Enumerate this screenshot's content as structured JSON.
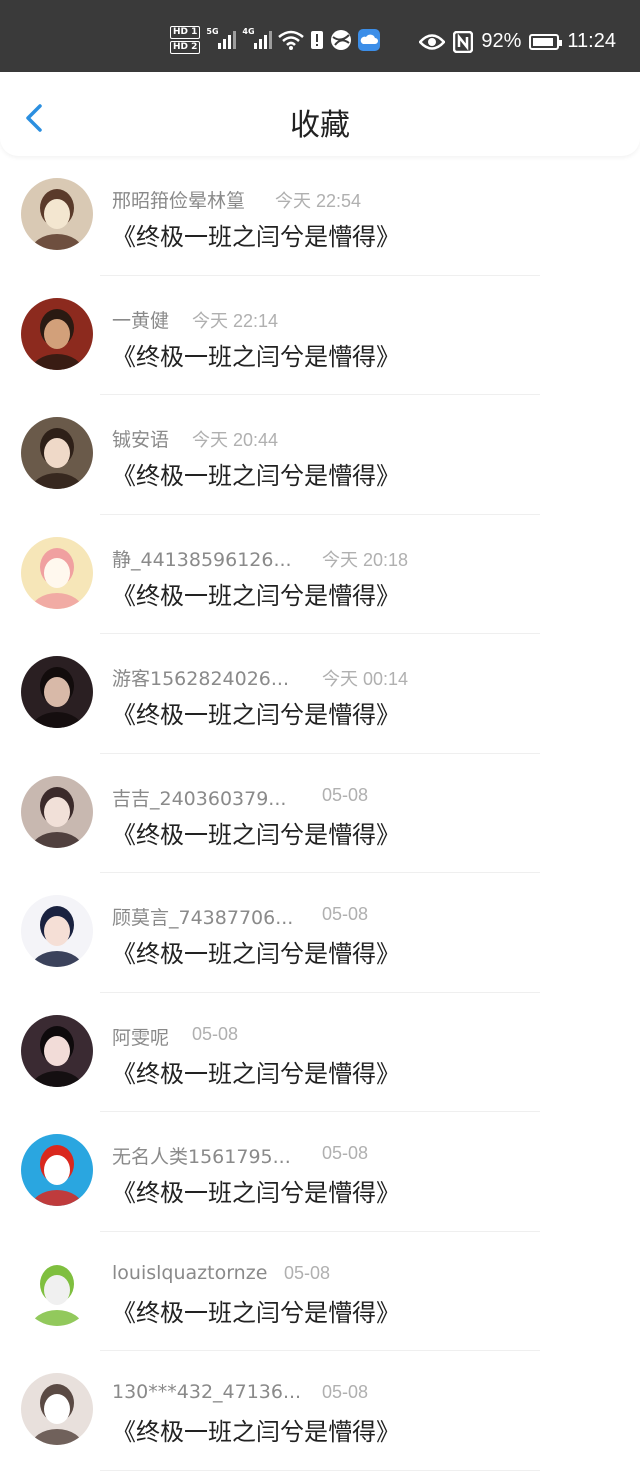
{
  "status_bar": {
    "hd1": "HD 1",
    "hd2": "HD 2",
    "net1": "5G",
    "net2": "4G",
    "battery_percent": "92%",
    "time": "11:24",
    "battery_level": 0.92
  },
  "nav": {
    "title": "收藏",
    "back_icon": "chevron-left-icon",
    "accent": "#2b8fe0"
  },
  "items": [
    {
      "name": "邢昭箝俭晕林篁",
      "time": "今天 22:54",
      "content": "《终极一班之闫兮是懵得》",
      "avatar": {
        "bg": "#d9c9b4",
        "fg": "#f3e6d0",
        "hair": "#5a3a2a"
      }
    },
    {
      "name": "一黄健",
      "time": "今天 22:14",
      "content": "《终极一班之闫兮是懵得》",
      "avatar": {
        "bg": "#8c2a1e",
        "fg": "#d2a07a",
        "hair": "#2a1a12"
      }
    },
    {
      "name": "铖安语",
      "time": "今天 20:44",
      "content": "《终极一班之闫兮是懵得》",
      "avatar": {
        "bg": "#6a5a4a",
        "fg": "#efd9c8",
        "hair": "#2e2018"
      }
    },
    {
      "name": "静_44138596126...",
      "time": "今天 20:18",
      "content": "《终极一班之闫兮是懵得》",
      "avatar": {
        "bg": "#f6e6b8",
        "fg": "#fff8ee",
        "hair": "#f0a0a0"
      }
    },
    {
      "name": "游客1562824026...",
      "time": "今天 00:14",
      "content": "《终极一班之闫兮是懵得》",
      "avatar": {
        "bg": "#2a1f22",
        "fg": "#d8b9a8",
        "hair": "#120c0c"
      }
    },
    {
      "name": "吉吉_240360379...",
      "time": "05-08",
      "content": "《终极一班之闫兮是懵得》",
      "avatar": {
        "bg": "#c8b8b0",
        "fg": "#f1e0d8",
        "hair": "#3b2a2a"
      }
    },
    {
      "name": "顾莫言_74387706...",
      "time": "05-08",
      "content": "《终极一班之闫兮是懵得》",
      "avatar": {
        "bg": "#f4f4f8",
        "fg": "#f5dfd6",
        "hair": "#1a2240"
      }
    },
    {
      "name": "阿雯呢",
      "time": "05-08",
      "content": "《终极一班之闫兮是懵得》",
      "avatar": {
        "bg": "#3a2a32",
        "fg": "#f2dcd8",
        "hair": "#0e0a0c"
      }
    },
    {
      "name": "无名人类1561795...",
      "time": "05-08",
      "content": "《终极一班之闫兮是懵得》",
      "avatar": {
        "bg": "#2aa6e0",
        "fg": "#ffffff",
        "hair": "#d9281e"
      }
    },
    {
      "name": "louislquaztornze",
      "time": "05-08",
      "content": "《终极一班之闫兮是懵得》",
      "avatar": {
        "bg": "#ffffff",
        "fg": "#f0f0f0",
        "hair": "#7fbf3f"
      }
    },
    {
      "name": "130***432_47136...",
      "time": "05-08",
      "content": "《终极一班之闫兮是懵得》",
      "avatar": {
        "bg": "#e8e0dc",
        "fg": "#ffffff",
        "hair": "#5a4a44"
      }
    }
  ]
}
